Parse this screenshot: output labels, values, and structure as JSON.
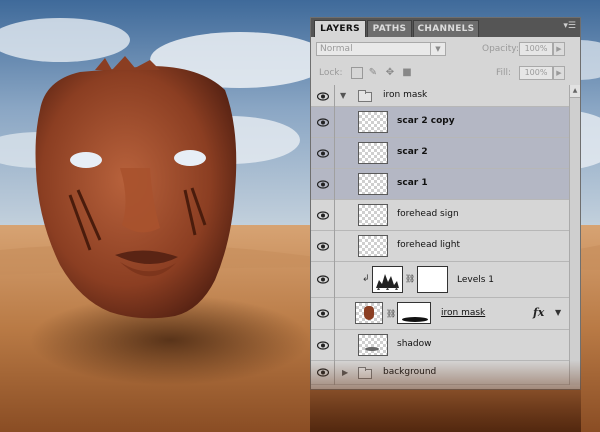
{
  "panel": {
    "tabs": [
      {
        "label": "LAYERS",
        "active": true
      },
      {
        "label": "PATHS",
        "active": false
      },
      {
        "label": "CHANNELS",
        "active": false
      }
    ],
    "menu_icon": "panel-menu-icon",
    "blend_mode": "Normal",
    "opacity_label": "Opacity:",
    "opacity_value": "100%",
    "lock_label": "Lock:",
    "fill_label": "Fill:",
    "fill_value": "100%"
  },
  "layers": [
    {
      "name": "iron mask",
      "type": "group",
      "expanded": true
    },
    {
      "name": "scar 2 copy",
      "type": "layer",
      "selected": true
    },
    {
      "name": "scar 2",
      "type": "layer",
      "selected": true
    },
    {
      "name": "scar 1",
      "type": "layer",
      "selected": true
    },
    {
      "name": "forehead sign",
      "type": "layer"
    },
    {
      "name": "forehead light",
      "type": "layer"
    },
    {
      "name": "Levels 1",
      "type": "adjustment"
    },
    {
      "name": "iron mask",
      "type": "masked-layer",
      "fx": "fx"
    },
    {
      "name": "shadow",
      "type": "layer"
    },
    {
      "name": "background",
      "type": "group",
      "expanded": false
    }
  ],
  "colors": {
    "panel_bg": "#d6d6d6",
    "selected_row": "#b4b7c4",
    "tab_bar": "#555555",
    "sky": "#6f8fb5",
    "sand": "#c98a52"
  }
}
